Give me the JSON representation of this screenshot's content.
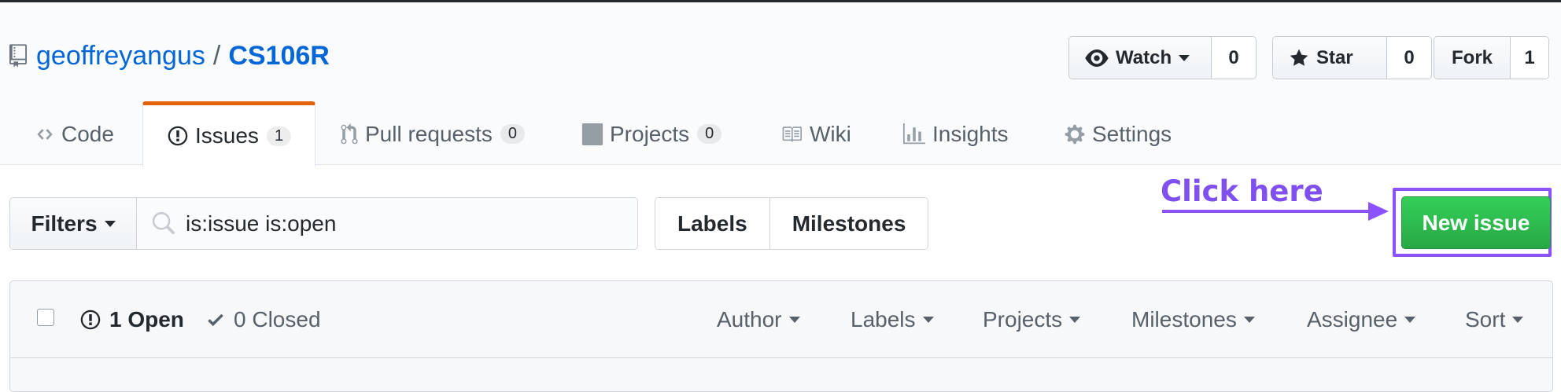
{
  "repo": {
    "owner": "geoffreyangus",
    "separator": "/",
    "name": "CS106R"
  },
  "actions": {
    "watch": {
      "label": "Watch",
      "count": "0"
    },
    "star": {
      "label": "Star",
      "count": "0"
    },
    "fork": {
      "label": "Fork",
      "count": "1"
    }
  },
  "tabs": [
    {
      "label": "Code"
    },
    {
      "label": "Issues",
      "count": "1"
    },
    {
      "label": "Pull requests",
      "count": "0"
    },
    {
      "label": "Projects",
      "count": "0"
    },
    {
      "label": "Wiki"
    },
    {
      "label": "Insights"
    },
    {
      "label": "Settings"
    }
  ],
  "filters": {
    "label": "Filters",
    "search_value": "is:issue is:open"
  },
  "labels_btn": "Labels",
  "milestones_btn": "Milestones",
  "annotation": {
    "text": "Click here",
    "color": "#8c52ff"
  },
  "new_issue": "New issue",
  "issues": {
    "open_label": "1 Open",
    "closed_label": "0 Closed",
    "menus": [
      "Author",
      "Labels",
      "Projects",
      "Milestones",
      "Assignee",
      "Sort"
    ]
  },
  "colors": {
    "link": "#0366d6",
    "accent_tab": "#e36209",
    "green": "#28a745"
  }
}
